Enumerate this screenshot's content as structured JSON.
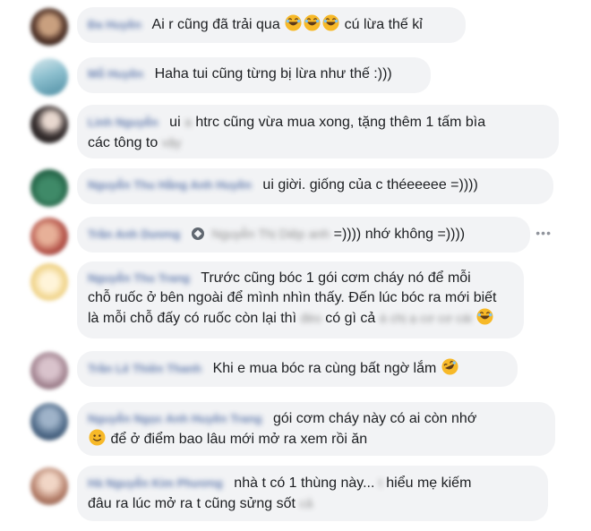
{
  "comments": [
    {
      "name": "Đa Huyền",
      "segments": [
        "Ai r cũng đã trải qua ",
        "cú lừa thế kỉ"
      ]
    },
    {
      "name": "Mỗ Huyền",
      "text": "Haha tui cũng từng bị lừa như thế :)))"
    },
    {
      "name": "Linh Nguyễn",
      "pre": "ui",
      "redact1": "a",
      "line1": "htrc cũng vừa mua xong, tặng thêm 1 tấm bìa",
      "line2": "các tông to",
      "redact2": "vậy"
    },
    {
      "name": "Nguyễn Thu Hằng Anh Huyền",
      "text": "ui giời. giống của c théeeeee =))))"
    },
    {
      "name": "Trần Anh Dương",
      "tagged": "Nguyễn Thị Diệp",
      "redact": "anh",
      "text": "=)))) nhớ không =))))"
    },
    {
      "name": "Nguyễn Thu Trang",
      "line1": "Trước cũng bóc 1 gói cơm cháy nó để mỗi",
      "line2": "chỗ ruốc ở bên ngoài để mình nhìn thấy. Đến lúc bóc ra mới biết",
      "line3a": "là mỗi chỗ đấy có ruốc còn lại thì",
      "redact1": "đéo",
      "line3b": "có gì cả",
      "redact2": "á chị ạ cơ cơ cái"
    },
    {
      "name": "Trần Lê Thiên Thanh",
      "text": "Khi e mua bóc ra cùng bất ngờ lắm"
    },
    {
      "name": "Nguyễn Ngọc Anh Huyền Trang",
      "line1": "gói cơm cháy này có ai còn nhớ",
      "line2": "để ở điểm bao lâu mới mở ra xem rồi ăn"
    },
    {
      "name": "Hà Nguyễn Kim Phương",
      "line1a": "nhà t có 1 thùng này...",
      "redact1": "t",
      "line1b": "hiểu mẹ kiếm",
      "line2": "đâu ra lúc mở ra t cũng sửng sốt",
      "redact2": "cả"
    }
  ],
  "more_label": "•••",
  "colors": {
    "bubble": "#f2f3f5",
    "name": "#385898",
    "text": "#1c1e21",
    "emoji": "#f7b928"
  },
  "icons": [
    "laughing-emoji",
    "rolling-laughing-emoji",
    "smiling-emoji",
    "tag-icon",
    "more-options-icon"
  ]
}
